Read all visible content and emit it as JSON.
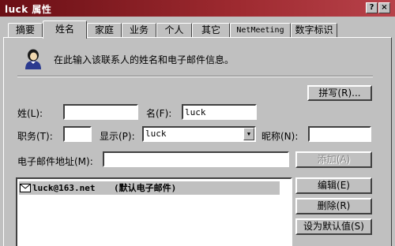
{
  "window": {
    "title": "luck 属性",
    "help_glyph": "?",
    "close_glyph": "×"
  },
  "tabs": [
    {
      "label": "摘要"
    },
    {
      "label": "姓名",
      "active": true
    },
    {
      "label": "家庭"
    },
    {
      "label": "业务"
    },
    {
      "label": "个人"
    },
    {
      "label": "其它"
    },
    {
      "label": "NetMeeting"
    },
    {
      "label": "数字标识"
    }
  ],
  "info_text": "在此输入该联系人的姓名和电子邮件信息。",
  "buttons": {
    "spell": "拼写(R)...",
    "add": "添加(A)",
    "edit": "编辑(E)",
    "remove": "删除(R)",
    "set_default": "设为默认值(S)"
  },
  "fields": {
    "last_name": {
      "label": "姓(L):",
      "value": ""
    },
    "first_name": {
      "label": "名(F):",
      "value": "luck"
    },
    "title": {
      "label": "职务(T):",
      "value": ""
    },
    "display": {
      "label": "显示(P):",
      "value": "luck"
    },
    "nickname": {
      "label": "昵称(N):",
      "value": ""
    },
    "email": {
      "label": "电子邮件地址(M):",
      "value": ""
    }
  },
  "email_list": [
    {
      "address": "luck@163.net",
      "note": "(默认电子邮件)"
    }
  ],
  "icons": {
    "person": "person-icon",
    "mail": "envelope-icon"
  }
}
